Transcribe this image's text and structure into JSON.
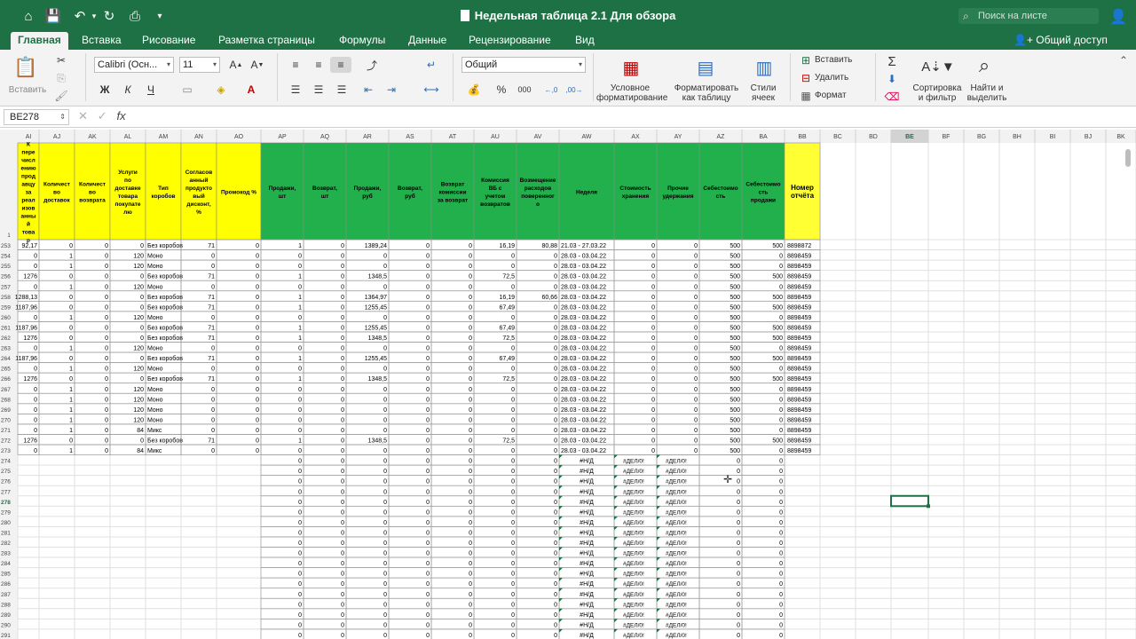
{
  "window": {
    "title": "Недельная таблица 2.1 Для обзора",
    "search_placeholder": "Поиск на листе",
    "share_label": "Общий доступ",
    "quick_access_icons": [
      "home-icon",
      "save-icon",
      "undo-icon",
      "redo-icon",
      "print-icon",
      "customize-icon"
    ]
  },
  "tabs": [
    "Главная",
    "Вставка",
    "Рисование",
    "Разметка страницы",
    "Формулы",
    "Данные",
    "Рецензирование",
    "Вид"
  ],
  "active_tab": "Главная",
  "ribbon": {
    "paste_label": "Вставить",
    "font_name": "Calibri (Осн...",
    "font_size": "11",
    "number_format": "Общий",
    "conditional_format": "Условное форматирование",
    "format_as_table": "Форматировать как таблицу",
    "cell_styles": "Стили ячеек",
    "insert_label": "Вставить",
    "delete_label": "Удалить",
    "format_label": "Формат",
    "sort_filter": "Сортировка и фильтр",
    "find_select": "Найти и выделить"
  },
  "formula_bar": {
    "name_box": "BE278",
    "fx": "fx",
    "content": ""
  },
  "sheet": {
    "columns": [
      "AI",
      "AJ",
      "AK",
      "AL",
      "AM",
      "AN",
      "AO",
      "AP",
      "AQ",
      "AR",
      "AS",
      "AT",
      "AU",
      "AV",
      "AW",
      "AX",
      "AY",
      "AZ",
      "BA",
      "BB",
      "BC",
      "BD",
      "BE",
      "BF",
      "BG",
      "BH",
      "BI",
      "BJ",
      "BK"
    ],
    "headers": [
      "К перечислению продавцу за реализованный товар",
      "Количество доставок",
      "Количество возврата",
      "Услуги по доставке товара покупателю",
      "Тип коробов",
      "Согласованный продуктовый дисконт, %",
      "Промокод %",
      "Продажи, шт",
      "Возврат, шт",
      "Продажи, руб",
      "Возврат, руб",
      "Возврат комиссии за возврат",
      "Комиссия ВБ с учетом возвратов",
      "Возмещение расходов поверенного",
      "Неделя",
      "Стоимость хранения",
      "Прочие удержания",
      "Себестоимость",
      "Себестоимость продажи",
      "Номер отчёта"
    ],
    "header_colors": {
      "yellow": "#ffff00",
      "green": "#22b04c",
      "number_col": "#ffff33"
    },
    "selected_cell": "BE278",
    "selected_row": "278",
    "partial_row": [
      "253",
      "92,17",
      "0",
      "0",
      "0",
      "Без коробов",
      "71",
      "0",
      "1",
      "0",
      "1389,24",
      "0",
      "0",
      "16,19",
      "80,88",
      "21.03 - 27.03.22",
      "0",
      "0",
      "500",
      "500",
      "8898872"
    ],
    "data_rows": [
      [
        "254",
        "0",
        "1",
        "0",
        "120",
        "Моно",
        "0",
        "0",
        "0",
        "0",
        "0",
        "0",
        "0",
        "0",
        "0",
        "28.03 - 03.04.22",
        "0",
        "0",
        "500",
        "0",
        "8898459"
      ],
      [
        "255",
        "0",
        "1",
        "0",
        "120",
        "Моно",
        "0",
        "0",
        "0",
        "0",
        "0",
        "0",
        "0",
        "0",
        "0",
        "28.03 - 03.04.22",
        "0",
        "0",
        "500",
        "0",
        "8898459"
      ],
      [
        "256",
        "1276",
        "0",
        "0",
        "0",
        "Без коробов",
        "71",
        "0",
        "1",
        "0",
        "1348,5",
        "0",
        "0",
        "72,5",
        "0",
        "28.03 - 03.04.22",
        "0",
        "0",
        "500",
        "500",
        "8898459"
      ],
      [
        "257",
        "0",
        "1",
        "0",
        "120",
        "Моно",
        "0",
        "0",
        "0",
        "0",
        "0",
        "0",
        "0",
        "0",
        "0",
        "28.03 - 03.04.22",
        "0",
        "0",
        "500",
        "0",
        "8898459"
      ],
      [
        "258",
        "1288,13",
        "0",
        "0",
        "0",
        "Без коробов",
        "71",
        "0",
        "1",
        "0",
        "1364,97",
        "0",
        "0",
        "16,19",
        "60,66",
        "28.03 - 03.04.22",
        "0",
        "0",
        "500",
        "500",
        "8898459"
      ],
      [
        "259",
        "1187,96",
        "0",
        "0",
        "0",
        "Без коробов",
        "71",
        "0",
        "1",
        "0",
        "1255,45",
        "0",
        "0",
        "67,49",
        "0",
        "28.03 - 03.04.22",
        "0",
        "0",
        "500",
        "500",
        "8898459"
      ],
      [
        "260",
        "0",
        "1",
        "0",
        "120",
        "Моно",
        "0",
        "0",
        "0",
        "0",
        "0",
        "0",
        "0",
        "0",
        "0",
        "28.03 - 03.04.22",
        "0",
        "0",
        "500",
        "0",
        "8898459"
      ],
      [
        "261",
        "1187,96",
        "0",
        "0",
        "0",
        "Без коробов",
        "71",
        "0",
        "1",
        "0",
        "1255,45",
        "0",
        "0",
        "67,49",
        "0",
        "28.03 - 03.04.22",
        "0",
        "0",
        "500",
        "500",
        "8898459"
      ],
      [
        "262",
        "1276",
        "0",
        "0",
        "0",
        "Без коробов",
        "71",
        "0",
        "1",
        "0",
        "1348,5",
        "0",
        "0",
        "72,5",
        "0",
        "28.03 - 03.04.22",
        "0",
        "0",
        "500",
        "500",
        "8898459"
      ],
      [
        "263",
        "0",
        "1",
        "0",
        "120",
        "Моно",
        "0",
        "0",
        "0",
        "0",
        "0",
        "0",
        "0",
        "0",
        "0",
        "28.03 - 03.04.22",
        "0",
        "0",
        "500",
        "0",
        "8898459"
      ],
      [
        "264",
        "1187,96",
        "0",
        "0",
        "0",
        "Без коробов",
        "71",
        "0",
        "1",
        "0",
        "1255,45",
        "0",
        "0",
        "67,49",
        "0",
        "28.03 - 03.04.22",
        "0",
        "0",
        "500",
        "500",
        "8898459"
      ],
      [
        "265",
        "0",
        "1",
        "0",
        "120",
        "Моно",
        "0",
        "0",
        "0",
        "0",
        "0",
        "0",
        "0",
        "0",
        "0",
        "28.03 - 03.04.22",
        "0",
        "0",
        "500",
        "0",
        "8898459"
      ],
      [
        "266",
        "1276",
        "0",
        "0",
        "0",
        "Без коробов",
        "71",
        "0",
        "1",
        "0",
        "1348,5",
        "0",
        "0",
        "72,5",
        "0",
        "28.03 - 03.04.22",
        "0",
        "0",
        "500",
        "500",
        "8898459"
      ],
      [
        "267",
        "0",
        "1",
        "0",
        "120",
        "Моно",
        "0",
        "0",
        "0",
        "0",
        "0",
        "0",
        "0",
        "0",
        "0",
        "28.03 - 03.04.22",
        "0",
        "0",
        "500",
        "0",
        "8898459"
      ],
      [
        "268",
        "0",
        "1",
        "0",
        "120",
        "Моно",
        "0",
        "0",
        "0",
        "0",
        "0",
        "0",
        "0",
        "0",
        "0",
        "28.03 - 03.04.22",
        "0",
        "0",
        "500",
        "0",
        "8898459"
      ],
      [
        "269",
        "0",
        "1",
        "0",
        "120",
        "Моно",
        "0",
        "0",
        "0",
        "0",
        "0",
        "0",
        "0",
        "0",
        "0",
        "28.03 - 03.04.22",
        "0",
        "0",
        "500",
        "0",
        "8898459"
      ],
      [
        "270",
        "0",
        "1",
        "0",
        "120",
        "Моно",
        "0",
        "0",
        "0",
        "0",
        "0",
        "0",
        "0",
        "0",
        "0",
        "28.03 - 03.04.22",
        "0",
        "0",
        "500",
        "0",
        "8898459"
      ],
      [
        "271",
        "0",
        "1",
        "0",
        "84",
        "Микс",
        "0",
        "0",
        "0",
        "0",
        "0",
        "0",
        "0",
        "0",
        "0",
        "28.03 - 03.04.22",
        "0",
        "0",
        "500",
        "0",
        "8898459"
      ],
      [
        "272",
        "1276",
        "0",
        "0",
        "0",
        "Без коробов",
        "71",
        "0",
        "1",
        "0",
        "1348,5",
        "0",
        "0",
        "72,5",
        "0",
        "28.03 - 03.04.22",
        "0",
        "0",
        "500",
        "500",
        "8898459"
      ],
      [
        "273",
        "0",
        "1",
        "0",
        "84",
        "Микс",
        "0",
        "0",
        "0",
        "0",
        "0",
        "0",
        "0",
        "0",
        "0",
        "28.03 - 03.04.22",
        "0",
        "0",
        "500",
        "0",
        "8898459"
      ]
    ],
    "error_rows": [
      "274",
      "275",
      "276",
      "277",
      "278",
      "279",
      "280",
      "281",
      "282",
      "283",
      "284",
      "285",
      "286",
      "287",
      "288",
      "289",
      "290",
      "291"
    ],
    "error_values": {
      "zero": "0",
      "na": "#Н/Д",
      "div": "#ДЕЛ/0!"
    }
  }
}
